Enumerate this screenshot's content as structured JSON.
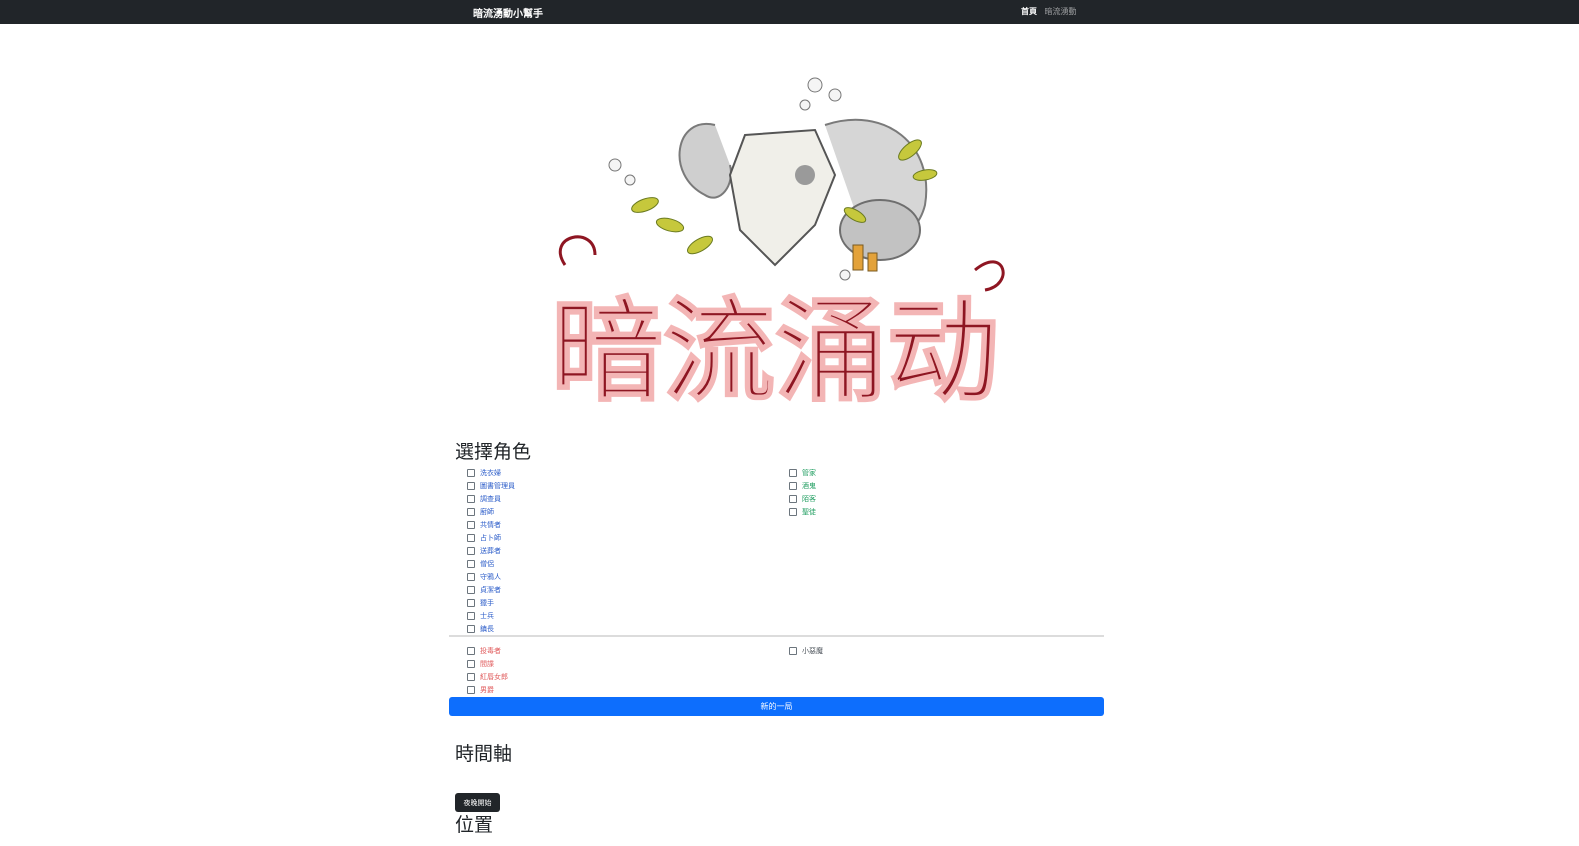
{
  "navbar": {
    "brand": "暗流湧動小幫手",
    "links": [
      {
        "label": "首頁",
        "active": true
      },
      {
        "label": "暗流湧動",
        "active": false
      }
    ]
  },
  "logo": {
    "title": "暗流涌动",
    "icon": "ram-skull-logo"
  },
  "role_section": {
    "heading": "選擇角色",
    "townsfolk": [
      "洗衣婦",
      "圖書管理員",
      "調查員",
      "廚師",
      "共情者",
      "占卜師",
      "送葬者",
      "僧侶",
      "守鴉人",
      "貞潔者",
      "獵手",
      "士兵",
      "鎮長"
    ],
    "outsiders": [
      "管家",
      "酒鬼",
      "陌客",
      "聖徒"
    ],
    "minions_demons": [
      "投毒者",
      "間諜",
      "紅唇女郎",
      "男爵"
    ],
    "demons": [
      "小惡魔"
    ],
    "new_game_label": "新的一局"
  },
  "timeline": {
    "heading": "時間軸",
    "night_button": "夜晚開始"
  },
  "position": {
    "heading": "位置"
  },
  "colors": {
    "navbar": "#212529",
    "primary": "#0d6efd",
    "townsfolk": "#2b5cc9",
    "outsider": "#1e9d5f",
    "evil": "#e0595a"
  }
}
